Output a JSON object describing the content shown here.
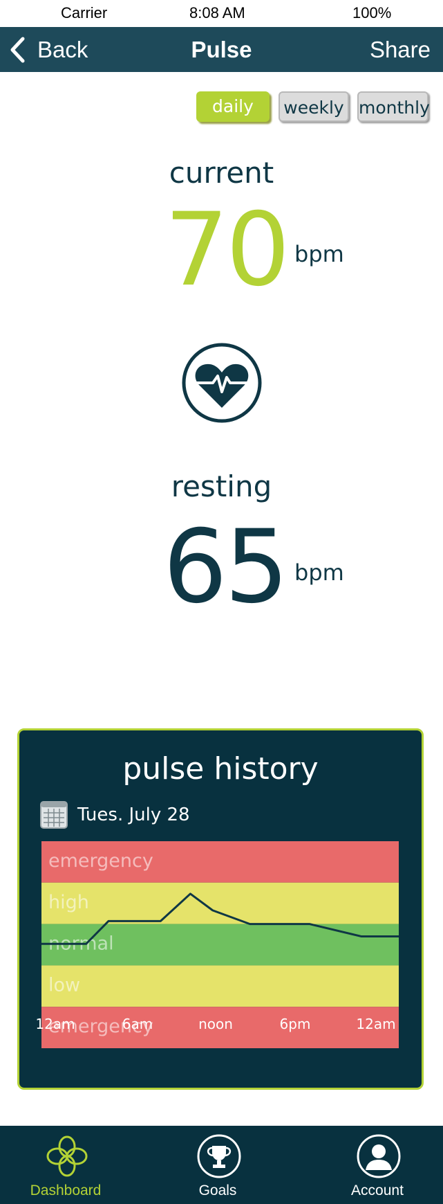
{
  "status_bar": {
    "carrier": "Carrier",
    "time": "8:08 AM",
    "battery": "100%"
  },
  "nav": {
    "back_label": "Back",
    "title": "Pulse",
    "share_label": "Share"
  },
  "period_tabs": {
    "daily": "daily",
    "weekly": "weekly",
    "monthly": "monthly",
    "selected": "daily"
  },
  "current": {
    "label": "current",
    "value": "70",
    "unit": "bpm"
  },
  "resting": {
    "label": "resting",
    "value": "65",
    "unit": "bpm"
  },
  "history": {
    "title": "pulse history",
    "date": "Tues. July 28",
    "colors": {
      "emergency": "#e86a6a",
      "high": "#e5e36a",
      "normal": "#6fc05f",
      "low": "#e5e36a"
    },
    "chart_data": {
      "type": "line",
      "bands": [
        "emergency",
        "high",
        "normal",
        "low",
        "emergency"
      ],
      "x_ticks": [
        "12am",
        "6am",
        "noon",
        "6pm",
        "12am"
      ],
      "series": [
        {
          "values": [
            {
              "x": "12am",
              "y_band_pos": 2.48
            },
            {
              "x": "3am",
              "y_band_pos": 2.48
            },
            {
              "x": "4:30am",
              "y_band_pos": 1.93
            },
            {
              "x": "8am",
              "y_band_pos": 1.93
            },
            {
              "x": "10am",
              "y_band_pos": 1.27
            },
            {
              "x": "11:30am",
              "y_band_pos": 1.67
            },
            {
              "x": "2pm",
              "y_band_pos": 2.0
            },
            {
              "x": "6pm",
              "y_band_pos": 2.0
            },
            {
              "x": "9:30pm",
              "y_band_pos": 2.3
            },
            {
              "x": "12am",
              "y_band_pos": 2.3
            }
          ]
        }
      ]
    }
  },
  "tabbar": {
    "dashboard": "Dashboard",
    "goals": "Goals",
    "account": "Account",
    "active": "dashboard",
    "active_color": "#b3d235"
  }
}
